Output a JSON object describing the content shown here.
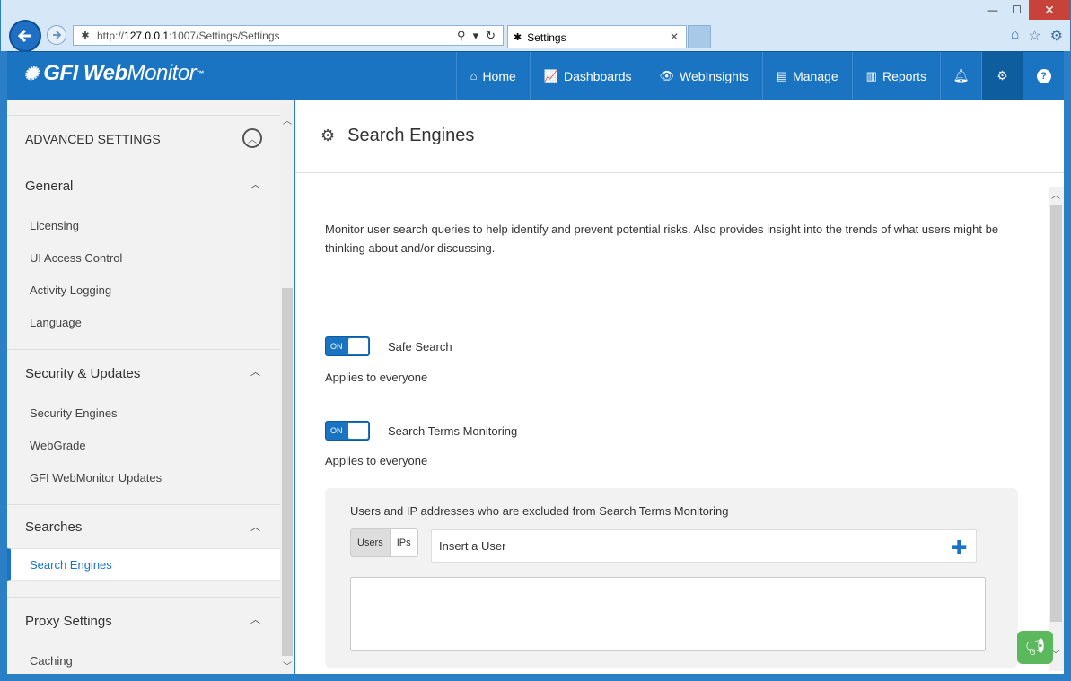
{
  "browser": {
    "url_prefix": "http://",
    "url_host": "127.0.0.1",
    "url_path": ":1007/Settings/Settings",
    "tab_title": "Settings"
  },
  "app": {
    "logo_bold": "GFI Web",
    "logo_light": "Monitor",
    "logo_tm": "™"
  },
  "nav": {
    "home": "Home",
    "dashboards": "Dashboards",
    "webinsights": "WebInsights",
    "manage": "Manage",
    "reports": "Reports"
  },
  "sidebar": {
    "advanced": "ADVANCED SETTINGS",
    "groups": [
      {
        "title": "General",
        "items": [
          "Licensing",
          "UI Access Control",
          "Activity Logging",
          "Language"
        ]
      },
      {
        "title": "Security & Updates",
        "items": [
          "Security Engines",
          "WebGrade",
          "GFI WebMonitor Updates"
        ]
      },
      {
        "title": "Searches",
        "items": [
          "Search Engines"
        ]
      },
      {
        "title": "Proxy Settings",
        "items": [
          "Caching"
        ]
      }
    ]
  },
  "main": {
    "title": "Search Engines",
    "description": "Monitor user search queries to help identify and prevent potential risks. Also provides insight into the trends of what users might be thinking about and/or discussing.",
    "toggle1": {
      "state": "ON",
      "label": "Safe Search",
      "applies": "Applies to everyone"
    },
    "toggle2": {
      "state": "ON",
      "label": "Search Terms Monitoring",
      "applies": "Applies to everyone"
    },
    "excluded_title": "Users and IP addresses who are excluded from Search Terms Monitoring",
    "seg_users": "Users",
    "seg_ips": "IPs",
    "insert_placeholder": "Insert a User"
  }
}
